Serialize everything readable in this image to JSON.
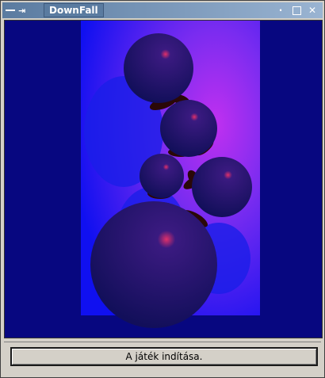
{
  "window": {
    "title": "DownFall",
    "menu_icon": "window-menu-icon",
    "pin_icon": "pin-icon",
    "controls": [
      "shade-icon",
      "maximize-icon",
      "close-icon"
    ]
  },
  "game": {
    "status_text": "A játék indítása."
  },
  "colors": {
    "background": "#070780",
    "board_gradient_center": "#c030f0",
    "board_gradient_edge": "#1010f0",
    "ball": "#1a1466",
    "links": "#2a0808"
  }
}
